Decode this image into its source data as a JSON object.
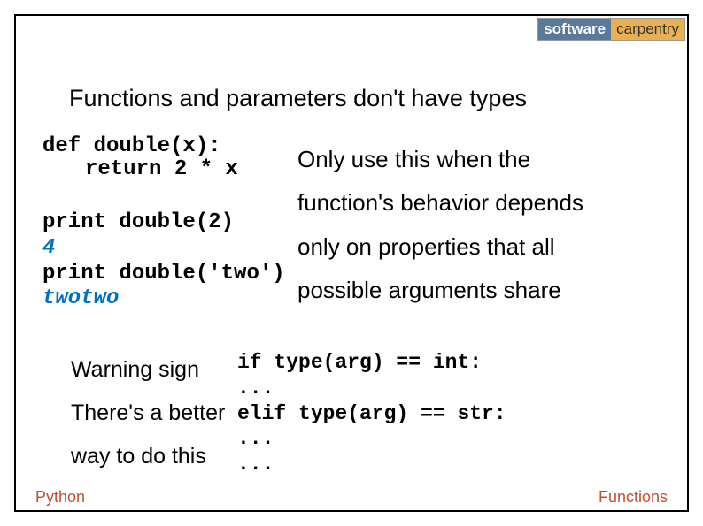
{
  "logo": {
    "left": "software",
    "right": "carpentry"
  },
  "title": "Functions and parameters don't have types",
  "code1": {
    "l1": "def double(x):",
    "l2": "return 2 * x"
  },
  "code2": {
    "l1": "print double(2)",
    "out1": "4",
    "l2": "print double('two')",
    "out2": "twotwo"
  },
  "desc": {
    "l1": "Only use this when the",
    "l2": "function's behavior depends",
    "l3": "only on properties that all",
    "l4": "possible arguments share"
  },
  "warning": {
    "l1": "Warning sign",
    "l2": "There's a better",
    "l3": "way to do this"
  },
  "code3": {
    "l1": "if type(arg) == int:",
    "l2": "    ...",
    "l3": "elif type(arg) == str:",
    "l4": "    ...",
    "l5": "..."
  },
  "footer": {
    "left": "Python",
    "right": "Functions"
  }
}
